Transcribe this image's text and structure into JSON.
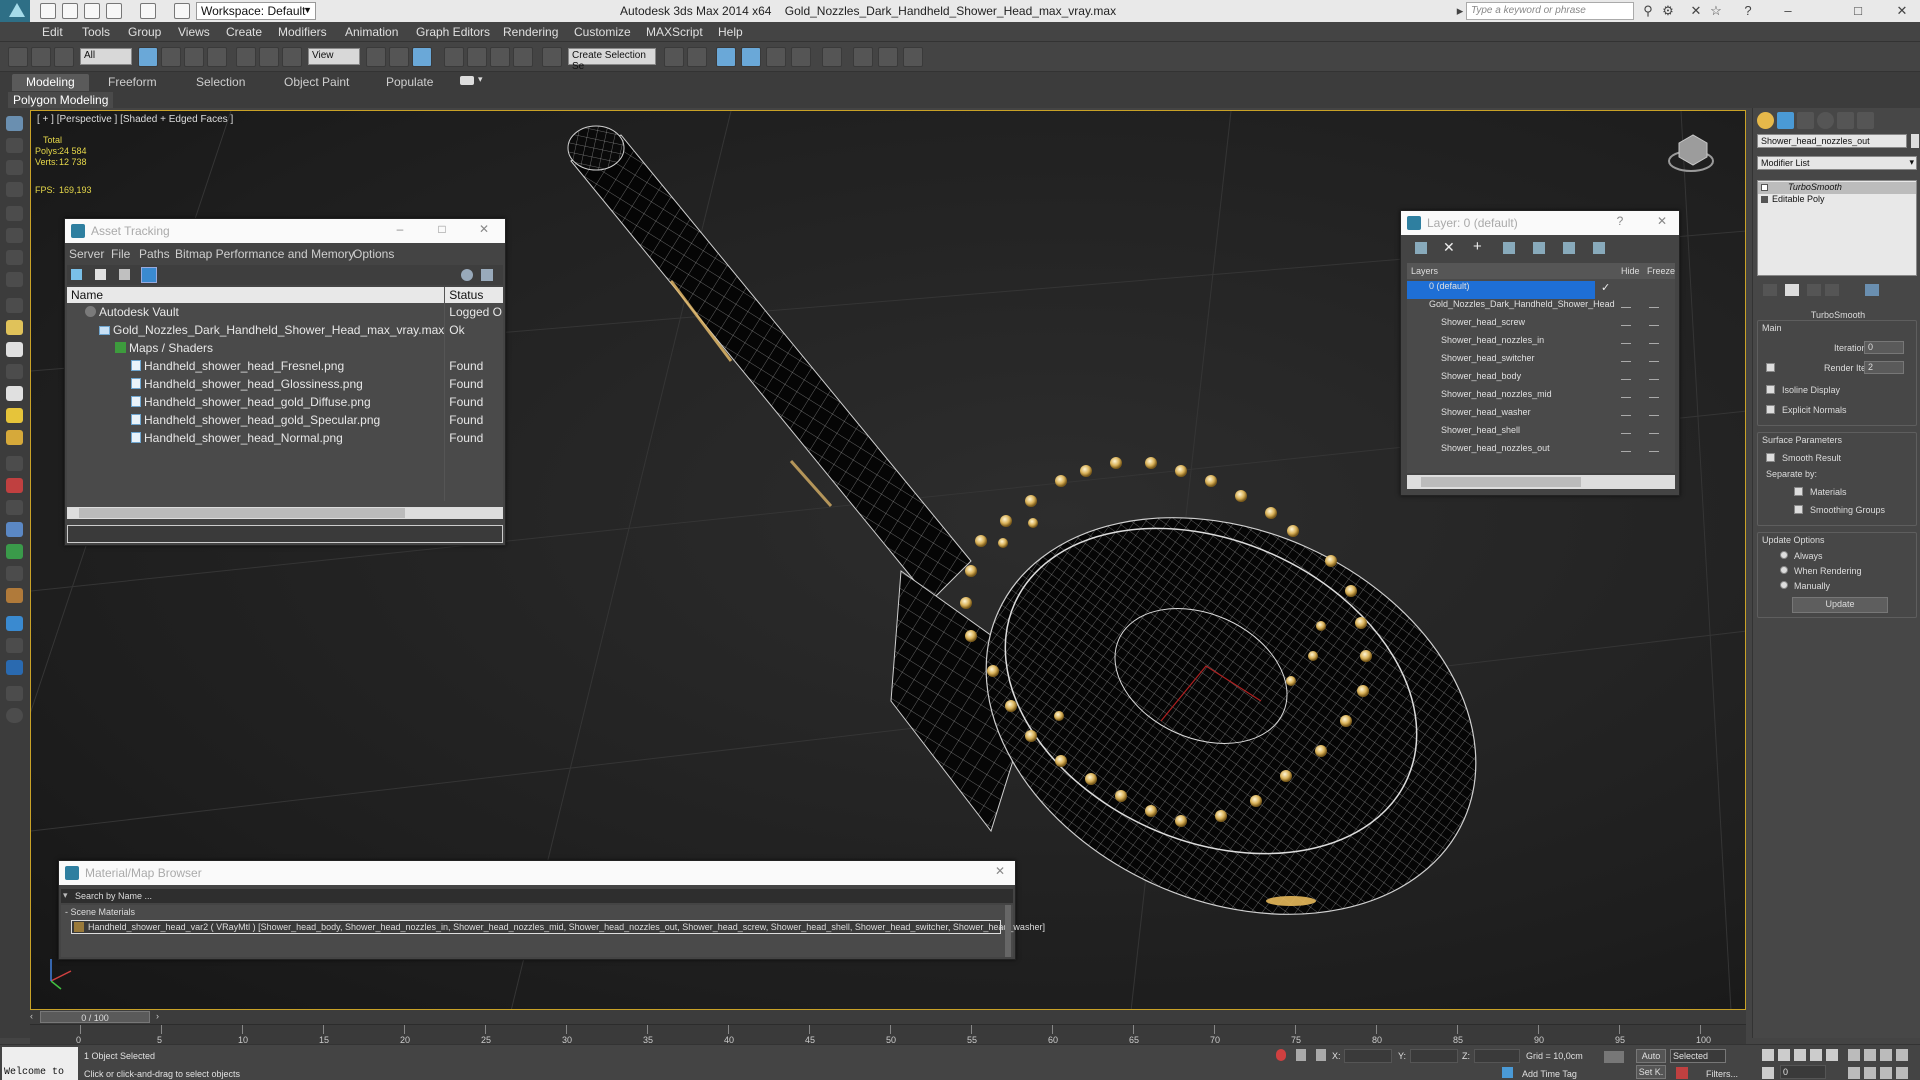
{
  "titlebar": {
    "workspace": "Workspace: Default",
    "app_title": "Autodesk 3ds Max  2014 x64",
    "file_name": "Gold_Nozzles_Dark_Handheld_Shower_Head_max_vray.max",
    "search_placeholder": "Type a keyword or phrase"
  },
  "menu": [
    "Edit",
    "Tools",
    "Group",
    "Views",
    "Create",
    "Modifiers",
    "Animation",
    "Graph Editors",
    "Rendering",
    "Customize",
    "MAXScript",
    "Help"
  ],
  "toolbar": {
    "filter_select": "All",
    "ref_coord": "View",
    "selection_set": "Create Selection Se"
  },
  "ribbon": {
    "tabs": [
      "Modeling",
      "Freeform",
      "Selection",
      "Object Paint",
      "Populate"
    ],
    "active_tab": "Modeling",
    "subpanel": "Polygon Modeling"
  },
  "viewport": {
    "label": "[ + ] [Perspective ] [Shaded + Edged Faces ]",
    "stats": {
      "total_label": "Total",
      "polys_label": "Polys:",
      "polys": "24 584",
      "verts_label": "Verts:",
      "verts": "12 738",
      "fps_label": "FPS:",
      "fps": "169,193"
    }
  },
  "asset_tracking": {
    "title": "Asset Tracking",
    "menu": [
      "Server",
      "File",
      "Paths",
      "Bitmap Performance and Memory",
      "Options"
    ],
    "col_name": "Name",
    "col_status": "Status",
    "rows": [
      {
        "name": "Autodesk Vault",
        "status": "Logged O..."
      },
      {
        "name": "Gold_Nozzles_Dark_Handheld_Shower_Head_max_vray.max",
        "status": "Ok"
      },
      {
        "name": "Maps / Shaders",
        "status": ""
      },
      {
        "name": "Handheld_shower_head_Fresnel.png",
        "status": "Found"
      },
      {
        "name": "Handheld_shower_head_Glossiness.png",
        "status": "Found"
      },
      {
        "name": "Handheld_shower_head_gold_Diffuse.png",
        "status": "Found"
      },
      {
        "name": "Handheld_shower_head_gold_Specular.png",
        "status": "Found"
      },
      {
        "name": "Handheld_shower_head_Normal.png",
        "status": "Found"
      }
    ]
  },
  "layer_window": {
    "title": "Layer: 0 (default)",
    "col_layers": "Layers",
    "col_hide": "Hide",
    "col_freeze": "Freeze",
    "rows": [
      "0 (default)",
      "Gold_Nozzles_Dark_Handheld_Shower_Head",
      "Shower_head_screw",
      "Shower_head_nozzles_in",
      "Shower_head_switcher",
      "Shower_head_body",
      "Shower_head_nozzles_mid",
      "Shower_head_washer",
      "Shower_head_shell",
      "Shower_head_nozzles_out"
    ]
  },
  "material_browser": {
    "title": "Material/Map Browser",
    "search_placeholder": "Search by Name ...",
    "section": "- Scene Materials",
    "material": "Handheld_shower_head_var2  ( VRayMtl ) [Shower_head_body, Shower_head_nozzles_in, Shower_head_nozzles_mid, Shower_head_nozzles_out, Shower_head_screw, Shower_head_shell, Shower_head_switcher, Shower_head_washer]"
  },
  "command_panel": {
    "object_name": "Shower_head_nozzles_out",
    "modifier_list": "Modifier List",
    "stack": [
      "TurboSmooth",
      "Editable Poly"
    ],
    "rollout_title": "TurboSmooth",
    "main_label": "Main",
    "iterations_label": "Iterations:",
    "iterations": "0",
    "render_iters_label": "Render Iters:",
    "render_iters": "2",
    "isoline_label": "Isoline Display",
    "explicit_label": "Explicit Normals",
    "surface_label": "Surface Parameters",
    "smooth_label": "Smooth Result",
    "separate_label": "Separate by:",
    "materials_label": "Materials",
    "smoothing_label": "Smoothing Groups",
    "update_options_label": "Update Options",
    "always_label": "Always",
    "when_rendering_label": "When Rendering",
    "manually_label": "Manually",
    "update_button": "Update"
  },
  "timeline": {
    "frame": "0 / 100",
    "ticks": [
      "0",
      "5",
      "10",
      "15",
      "20",
      "25",
      "30",
      "35",
      "40",
      "45",
      "50",
      "55",
      "60",
      "65",
      "70",
      "75",
      "80",
      "85",
      "90",
      "95",
      "100"
    ]
  },
  "status": {
    "welcome": "Welcome to",
    "selected": "1 Object Selected",
    "hint": "Click or click-and-drag to select objects",
    "x_label": "X:",
    "y_label": "Y:",
    "z_label": "Z:",
    "grid": "Grid = 10,0cm",
    "add_time_tag": "Add Time Tag",
    "auto": "Auto",
    "set_key": "Set K.",
    "selected_dropdown": "Selected",
    "filters": "Filters...",
    "frame_field": "0"
  },
  "colors": {
    "viewport_border": "#c9a227",
    "selection_blue": "#1e6fd6",
    "stats_yellow": "#e6d84a",
    "gold_nozzle": "#d9b25a"
  }
}
